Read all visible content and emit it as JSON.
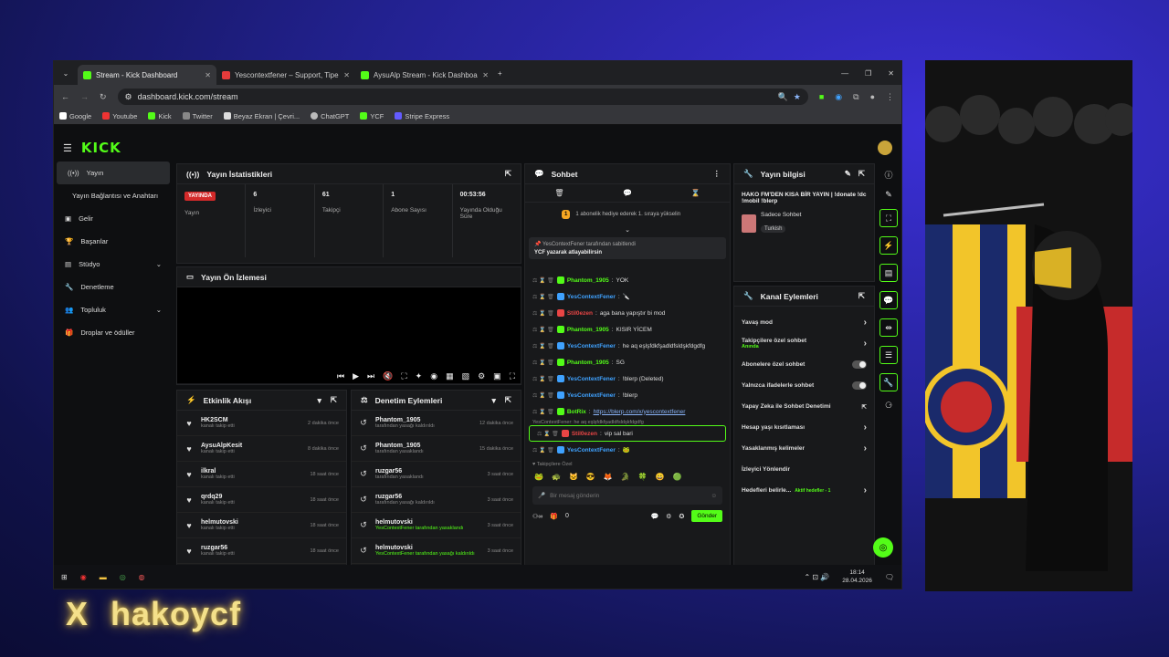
{
  "browser": {
    "tabs": [
      {
        "label": "Stream - Kick Dashboard",
        "favicon": "kick-icon"
      },
      {
        "label": "Yescontextfener – Support, Tipe",
        "favicon": "tipeee-icon"
      },
      {
        "label": "AysuAlp Stream - Kick Dashboa",
        "favicon": "kick-icon"
      }
    ],
    "url": "dashboard.kick.com/stream",
    "bookmarks": [
      "Google",
      "Youtube",
      "Kick",
      "Twitter",
      "Beyaz Ekran | Çevri...",
      "ChatGPT",
      "YCF",
      "Stripe Express"
    ]
  },
  "sidebar": {
    "items": [
      "Yayın",
      "Yayın Bağlantısı ve Anahtarı",
      "Gelir",
      "Başarılar",
      "Stüdyo",
      "Denetleme",
      "Topluluk",
      "Droplar ve ödüller"
    ]
  },
  "stats": {
    "title": "Yayın İstatistikleri",
    "live": "YAYINDA",
    "status_label": "Yayın",
    "viewers": "6",
    "viewers_label": "İzleyici",
    "followers": "61",
    "followers_label": "Takipçi",
    "subs": "1",
    "subs_label": "Abone Sayısı",
    "uptime": "00:53:56",
    "uptime_label": "Yayında Olduğu Süre"
  },
  "preview": {
    "title": "Yayın Ön İzlemesi"
  },
  "activity": {
    "title": "Etkinlik Akışı",
    "rows": [
      {
        "name": "HK2SCM",
        "sub": "kanalı takip etti",
        "time": "2 dakika önce"
      },
      {
        "name": "AysuAlpKesit",
        "sub": "kanalı takip etti",
        "time": "8 dakika önce"
      },
      {
        "name": "ilkral",
        "sub": "kanalı takip etti",
        "time": "18 saat önce"
      },
      {
        "name": "qrdq29",
        "sub": "kanalı takip etti",
        "time": "18 saat önce"
      },
      {
        "name": "helmutovski",
        "sub": "kanalı takip etti",
        "time": "18 saat önce"
      },
      {
        "name": "ruzgar56",
        "sub": "kanalı takip etti",
        "time": "18 saat önce"
      }
    ]
  },
  "mod": {
    "title": "Denetim Eylemleri",
    "rows": [
      {
        "name": "Phantom_1905",
        "sub": "tarafından yasağı kaldırıldı",
        "time": "12 dakika önce"
      },
      {
        "name": "Phantom_1905",
        "sub": "tarafından yasaklandı",
        "time": "15 dakika önce"
      },
      {
        "name": "ruzgar56",
        "sub": "tarafından yasaklandı",
        "time": "3 saat önce"
      },
      {
        "name": "ruzgar56",
        "sub": "tarafından yasağı kaldırıldı",
        "time": "3 saat önce"
      },
      {
        "name": "helmutovski",
        "sub": "YesContextFener tarafından yasaklandı",
        "time": "3 saat önce"
      },
      {
        "name": "helmutovski",
        "sub": "YesContextFener tarafından yasağı kaldırıldı",
        "time": "3 saat önce"
      }
    ]
  },
  "chat": {
    "title": "Sohbet",
    "goal": "1 abonelik hediye ederek 1. sıraya yükselin",
    "pinned_by": "YesContextFener tarafından sabitlendi",
    "pinned": "YCF yazarak atlayabilirsin",
    "messages": [
      {
        "u": "Phantom_1905",
        "c": "#53fc18",
        "t": "YOK"
      },
      {
        "u": "YesContextFener",
        "c": "#3fa2ff",
        "t": "🔪"
      },
      {
        "u": "Stil0ezen",
        "c": "#e84545",
        "t": "aga bana yapıştır bi mod"
      },
      {
        "u": "Phantom_1905",
        "c": "#53fc18",
        "t": "KISIR YİCEM"
      },
      {
        "u": "YesContextFener",
        "c": "#3fa2ff",
        "t": "he aq eşlşfdkfşadldfsldşkfdgdfg"
      },
      {
        "u": "Phantom_1905",
        "c": "#53fc18",
        "t": "SG"
      },
      {
        "u": "YesContextFener",
        "c": "#3fa2ff",
        "t": "!blerp (Deleted)"
      },
      {
        "u": "YesContextFener",
        "c": "#3fa2ff",
        "t": "!blerp"
      },
      {
        "u": "BotRix",
        "c": "#53fc18",
        "t": "https://blerp.com/x/yescontextfener"
      },
      {
        "u": "Stil0ezen",
        "c": "#e84545",
        "t": "vip sal bari"
      },
      {
        "u": "YesContextFener",
        "c": "#3fa2ff",
        "t": "🐸"
      }
    ],
    "reply": "YesContextFener: he aq eşlşfdkfşadldfsldşkfdgdfg",
    "emote_label": "Takipçilere Özel",
    "placeholder": "Bir mesaj gönderin",
    "send": "Gönder",
    "count": "0"
  },
  "info": {
    "title": "Yayın bilgisi",
    "stream_title": "HAKO FM'DEN KISA BİR YAYIN | !donate !dc !mobil !blerp",
    "category": "Sadece Sohbet",
    "tag": "Turkish"
  },
  "actions": {
    "title": "Kanal Eylemleri",
    "rows": [
      {
        "l": "Yavaş mod",
        "k": "chev"
      },
      {
        "l": "Takipçilere özel sohbet",
        "sub": "Anında",
        "k": "chev"
      },
      {
        "l": "Abonelere özel sohbet",
        "k": "tog"
      },
      {
        "l": "Yalnızca ifadelerle sohbet",
        "k": "tog"
      },
      {
        "l": "Yapay Zeka ile Sohbet Denetimi",
        "k": "ext"
      },
      {
        "l": "Hesap yaşı kısıtlaması",
        "k": "chev"
      },
      {
        "l": "Yasaklanmış kelimeler",
        "k": "chev"
      },
      {
        "l": "İzleyici Yönlendir",
        "k": ""
      },
      {
        "l": "Hedefleri belirle...",
        "sub2": "Aktif hedefler - 1",
        "k": "chev"
      }
    ]
  },
  "taskbar": {
    "time": "18:14",
    "date": "28.04.2026"
  },
  "overlay": {
    "handle": "hakoycf",
    "x": "X"
  },
  "colors": {
    "kick_green": "#53fc18",
    "live_red": "#d42a2a"
  }
}
